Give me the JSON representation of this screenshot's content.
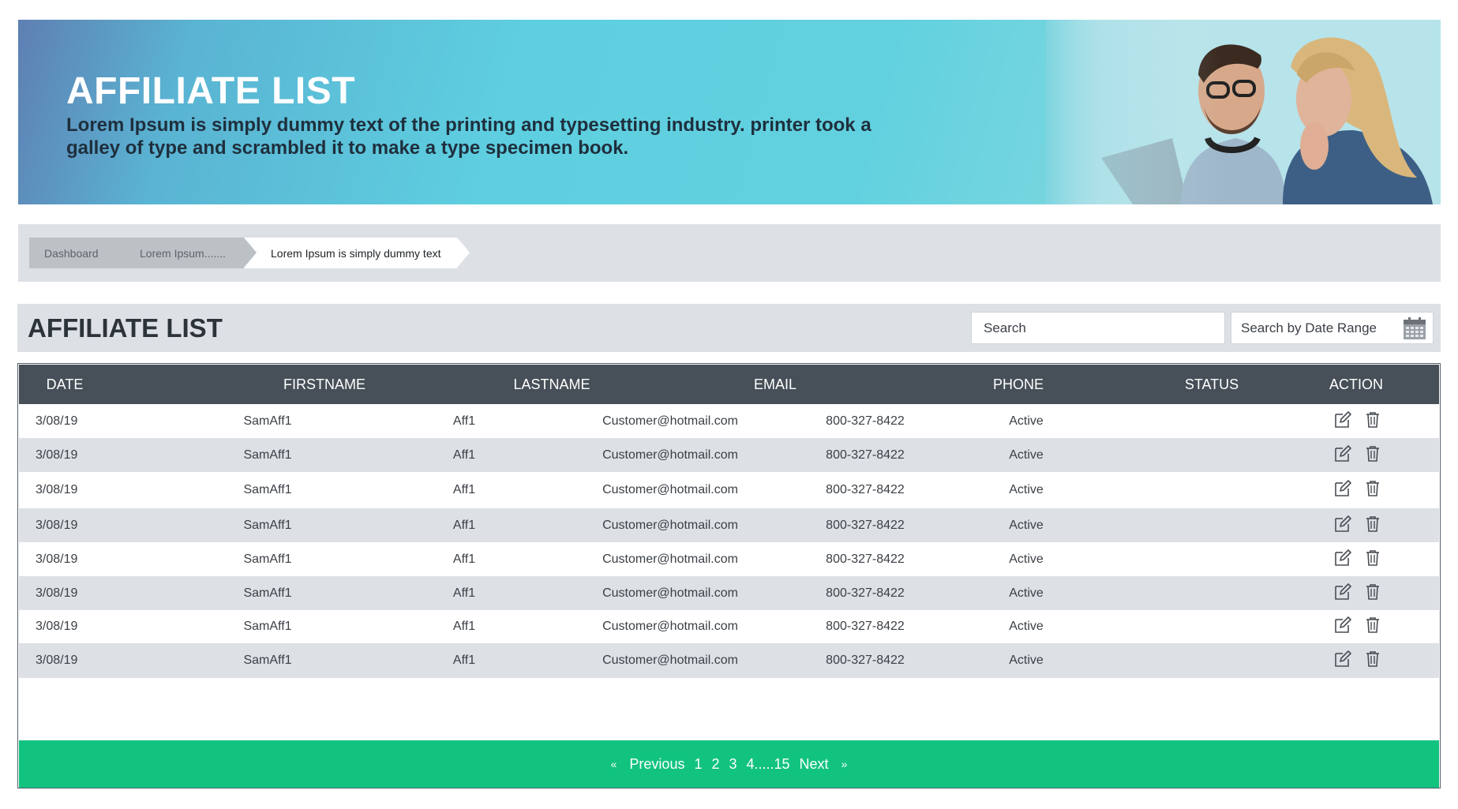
{
  "hero": {
    "title": "AFFILIATE LIST",
    "description": "Lorem Ipsum is simply dummy text of the printing and typesetting industry. printer took a galley of type and scrambled it to make a type specimen book."
  },
  "breadcrumb": {
    "items": [
      "Dashboard",
      "Lorem Ipsum.......",
      "Lorem Ipsum is simply dummy text"
    ]
  },
  "list": {
    "title": "AFFILIATE LIST",
    "search_placeholder": "Search",
    "date_placeholder": "Search by Date Range"
  },
  "table": {
    "columns": [
      "DATE",
      "FIRSTNAME",
      "LASTNAME",
      "EMAIL",
      "PHONE",
      "STATUS",
      "ACTION"
    ],
    "rows": [
      {
        "date": "3/08/19",
        "firstname": "SamAff1",
        "lastname": "Aff1",
        "email": "Customer@hotmail.com",
        "phone": "800-327-8422",
        "status": "Active"
      },
      {
        "date": "3/08/19",
        "firstname": "SamAff1",
        "lastname": "Aff1",
        "email": "Customer@hotmail.com",
        "phone": "800-327-8422",
        "status": "Active"
      },
      {
        "date": "3/08/19",
        "firstname": "SamAff1",
        "lastname": "Aff1",
        "email": "Customer@hotmail.com",
        "phone": "800-327-8422",
        "status": "Active"
      },
      {
        "date": "3/08/19",
        "firstname": "SamAff1",
        "lastname": "Aff1",
        "email": "Customer@hotmail.com",
        "phone": "800-327-8422",
        "status": "Active"
      },
      {
        "date": "3/08/19",
        "firstname": "SamAff1",
        "lastname": "Aff1",
        "email": "Customer@hotmail.com",
        "phone": "800-327-8422",
        "status": "Active"
      },
      {
        "date": "3/08/19",
        "firstname": "SamAff1",
        "lastname": "Aff1",
        "email": "Customer@hotmail.com",
        "phone": "800-327-8422",
        "status": "Active"
      },
      {
        "date": "3/08/19",
        "firstname": "SamAff1",
        "lastname": "Aff1",
        "email": "Customer@hotmail.com",
        "phone": "800-327-8422",
        "status": "Active"
      },
      {
        "date": "3/08/19",
        "firstname": "SamAff1",
        "lastname": "Aff1",
        "email": "Customer@hotmail.com",
        "phone": "800-327-8422",
        "status": "Active"
      }
    ],
    "actions": {
      "edit_icon": "edit-icon",
      "delete_icon": "trash-icon"
    }
  },
  "pagination": {
    "first_icon": "«",
    "previous": "Previous",
    "pages": [
      "1",
      "2",
      "3",
      "4.....15"
    ],
    "next": "Next",
    "last_icon": "»"
  },
  "colors": {
    "header_bg": "#475058",
    "alt_row": "#dde1e5",
    "pager_bg": "#12c380",
    "hero_accent": "#5ecfe0"
  }
}
